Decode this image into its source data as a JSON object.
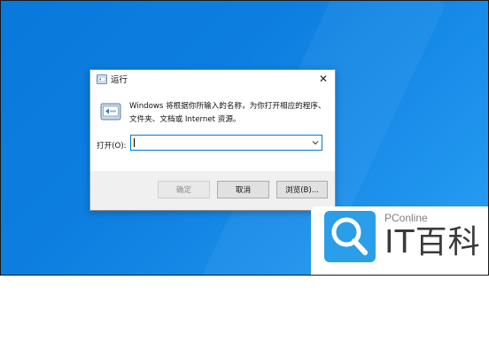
{
  "dialog": {
    "title": "运行",
    "description_line1": "Windows 将根据你所输入的名称，为你打开相应的程序、",
    "description_line2": "文件夹、文档或 Internet 资源。",
    "open_label": "打开(O):",
    "open_value": "",
    "buttons": {
      "ok": "确定",
      "cancel": "取消",
      "browse": "浏览(B)..."
    },
    "close_glyph": "✕"
  },
  "watermark": {
    "sub_text": "PConline",
    "brand_text": "IT百科",
    "accent_color": "#2a9ee8"
  },
  "colors": {
    "desktop_blue": "#0d7fe0",
    "input_focus": "#0078d7"
  },
  "icons": [
    "run-app-icon",
    "run-dialog-icon",
    "close-icon",
    "chevron-down-icon",
    "magnifier-logo-icon"
  ]
}
